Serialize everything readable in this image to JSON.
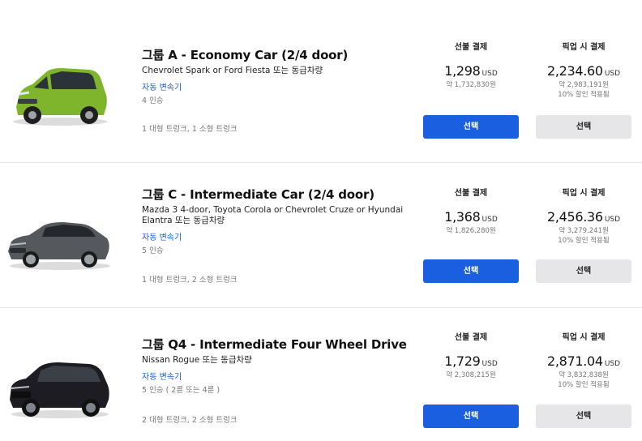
{
  "colors": {
    "accent": "#1a5fe0",
    "transmission_text": "#1a5fd6",
    "secondary_button": "#e6e6e8"
  },
  "vehicles": [
    {
      "title": "그룹 A - Economy Car (2/4 door)",
      "models": "Chevrolet Spark or Ford Fiesta 또는 동급차량",
      "transmission": "자동 변속기",
      "seats": "4 인승",
      "trunk": "1 대형 트렁크, 1 소형 트렁크",
      "car_color": "#7fb52c",
      "prepay": {
        "header": "선불 결제",
        "price": "1,298",
        "currency": "USD",
        "approx": "약 1,732,830원",
        "button": "선택"
      },
      "pickup": {
        "header": "픽업 시 결제",
        "price": "2,234.60",
        "currency": "USD",
        "approx": "약 2,983,191원",
        "discount": "10% 할인 적용됨",
        "button": "선택"
      }
    },
    {
      "title": "그룹 C - Intermediate Car (2/4 door)",
      "models": "Mazda 3 4-door, Toyota Corola or Chevrolet Cruze or Hyundai Elantra 또는 동급차량",
      "transmission": "자동 변속기",
      "seats": "5 인승",
      "trunk": "1 대형 트렁크, 2 소형 트렁크",
      "car_color": "#55585d",
      "prepay": {
        "header": "선불 결제",
        "price": "1,368",
        "currency": "USD",
        "approx": "약 1,826,280원",
        "button": "선택"
      },
      "pickup": {
        "header": "픽업 시 결제",
        "price": "2,456.36",
        "currency": "USD",
        "approx": "약 3,279,241원",
        "discount": "10% 할인 적용됨",
        "button": "선택"
      }
    },
    {
      "title": "그룹 Q4 - Intermediate Four Wheel Drive",
      "models": "Nissan Rogue 또는 동급차량",
      "transmission": "자동 변속기",
      "seats": "5 인승 ( 2륜 또는 4륜 )",
      "trunk": "2 대형 트렁크, 2 소형 트렁크",
      "car_color": "#1c1c22",
      "prepay": {
        "header": "선불 결제",
        "price": "1,729",
        "currency": "USD",
        "approx": "약 2,308,215원",
        "button": "선택"
      },
      "pickup": {
        "header": "픽업 시 결제",
        "price": "2,871.04",
        "currency": "USD",
        "approx": "약 3,832,838원",
        "discount": "10% 할인 적용됨",
        "button": "선택"
      }
    }
  ]
}
